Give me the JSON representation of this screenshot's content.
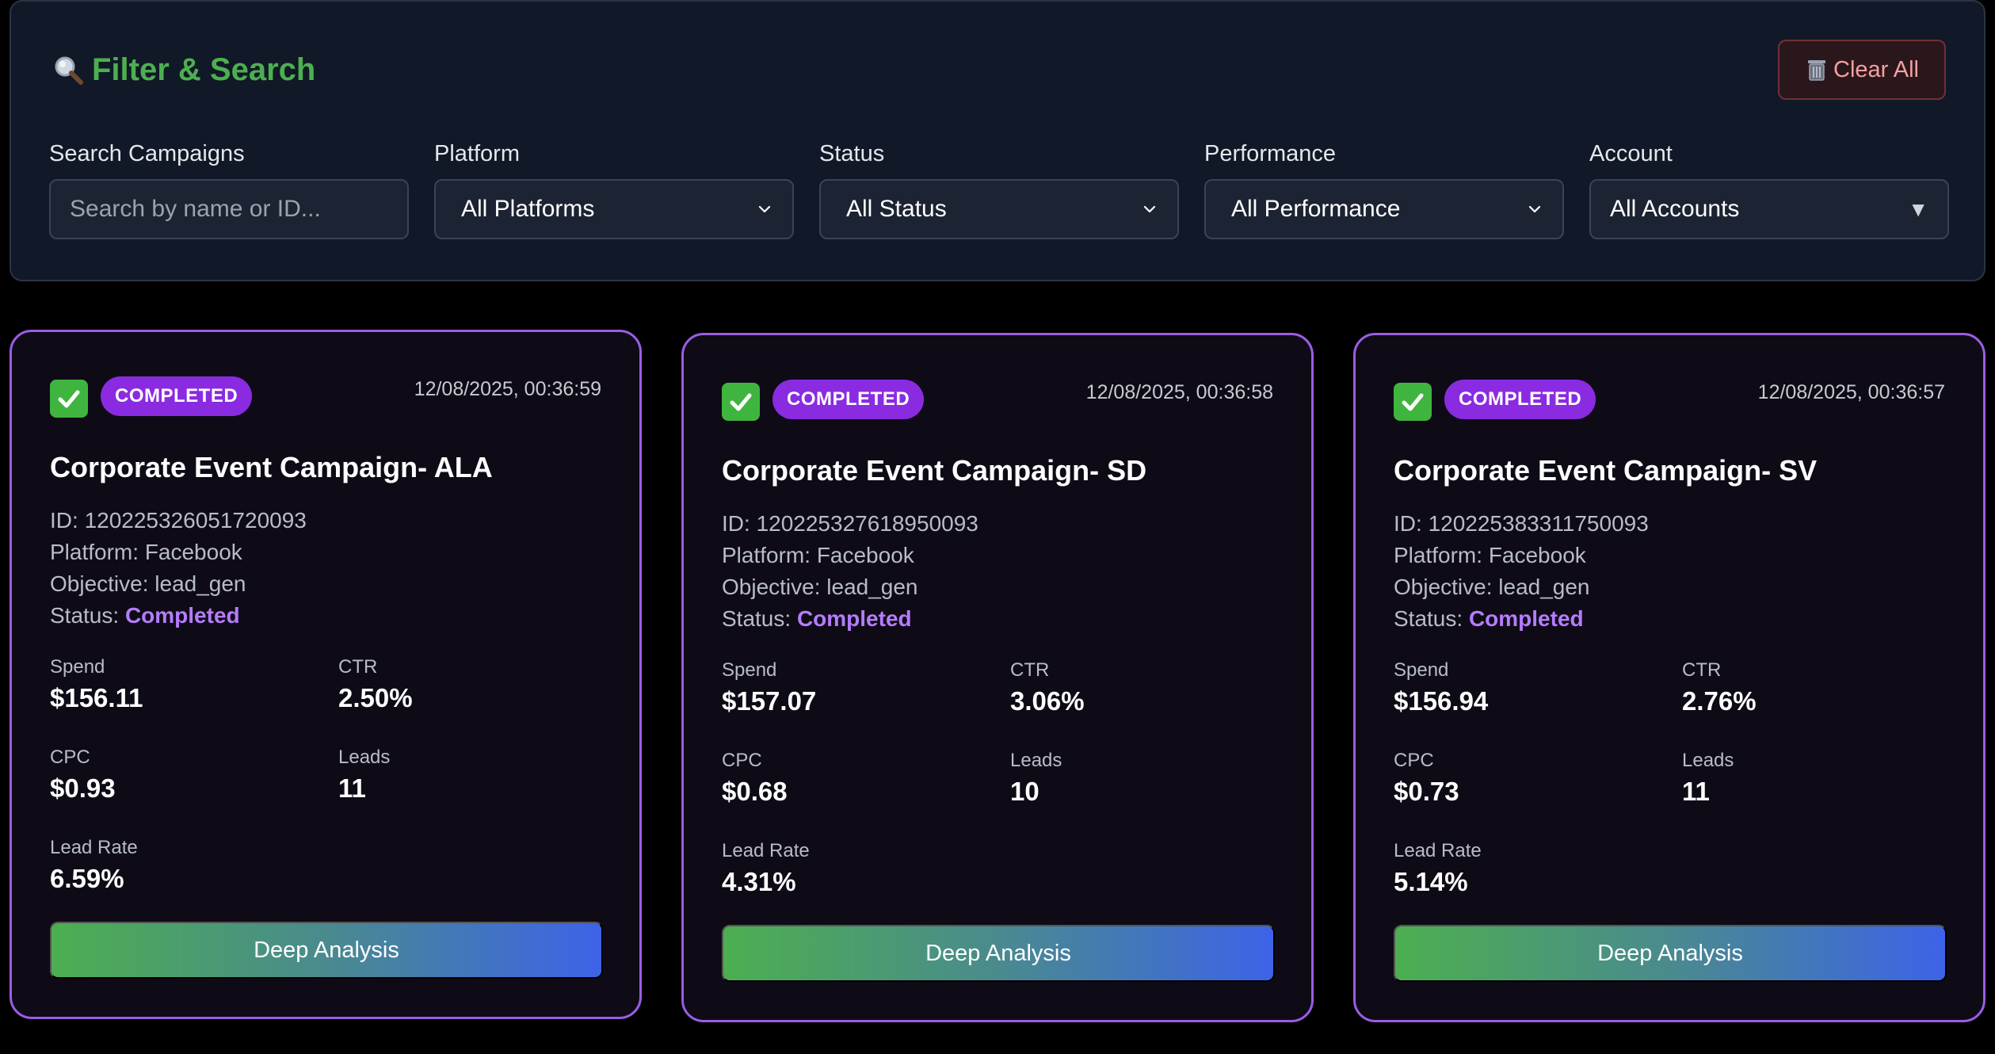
{
  "filter": {
    "title": "Filter & Search",
    "title_icon": "magnifier-icon",
    "clear_label": "Clear All",
    "clear_icon": "trash-icon",
    "search": {
      "label": "Search Campaigns",
      "placeholder": "Search by name or ID...",
      "value": ""
    },
    "platform": {
      "label": "Platform",
      "selected": "All Platforms"
    },
    "status": {
      "label": "Status",
      "selected": "All Status"
    },
    "performance": {
      "label": "Performance",
      "selected": "All Performance"
    },
    "account": {
      "label": "Account",
      "selected": "All Accounts"
    }
  },
  "colors": {
    "accent_green": "#4caf50",
    "card_border": "#9b5de5",
    "badge_bg": "#8a2be2",
    "status_text": "#b57cff",
    "button_gradient_start": "#4caf50",
    "button_gradient_end": "#3d63e8"
  },
  "cards": [
    {
      "badge": "COMPLETED",
      "timestamp": "12/08/2025, 00:36:59",
      "title": "Corporate Event Campaign- ALA",
      "id_label": "ID:",
      "id": "120225326051720093",
      "platform_label": "Platform:",
      "platform": "Facebook",
      "objective_label": "Objective:",
      "objective": "lead_gen",
      "status_label": "Status:",
      "status": "Completed",
      "spend_label": "Spend",
      "spend": "$156.11",
      "ctr_label": "CTR",
      "ctr": "2.50%",
      "cpc_label": "CPC",
      "cpc": "$0.93",
      "leads_label": "Leads",
      "leads": "11",
      "lead_rate_label": "Lead Rate",
      "lead_rate": "6.59%",
      "button": "Deep Analysis"
    },
    {
      "badge": "COMPLETED",
      "timestamp": "12/08/2025, 00:36:58",
      "title": "Corporate Event Campaign- SD",
      "id_label": "ID:",
      "id": "120225327618950093",
      "platform_label": "Platform:",
      "platform": "Facebook",
      "objective_label": "Objective:",
      "objective": "lead_gen",
      "status_label": "Status:",
      "status": "Completed",
      "spend_label": "Spend",
      "spend": "$157.07",
      "ctr_label": "CTR",
      "ctr": "3.06%",
      "cpc_label": "CPC",
      "cpc": "$0.68",
      "leads_label": "Leads",
      "leads": "10",
      "lead_rate_label": "Lead Rate",
      "lead_rate": "4.31%",
      "button": "Deep Analysis"
    },
    {
      "badge": "COMPLETED",
      "timestamp": "12/08/2025, 00:36:57",
      "title": "Corporate Event Campaign- SV",
      "id_label": "ID:",
      "id": "120225383311750093",
      "platform_label": "Platform:",
      "platform": "Facebook",
      "objective_label": "Objective:",
      "objective": "lead_gen",
      "status_label": "Status:",
      "status": "Completed",
      "spend_label": "Spend",
      "spend": "$156.94",
      "ctr_label": "CTR",
      "ctr": "2.76%",
      "cpc_label": "CPC",
      "cpc": "$0.73",
      "leads_label": "Leads",
      "leads": "11",
      "lead_rate_label": "Lead Rate",
      "lead_rate": "5.14%",
      "button": "Deep Analysis"
    }
  ]
}
